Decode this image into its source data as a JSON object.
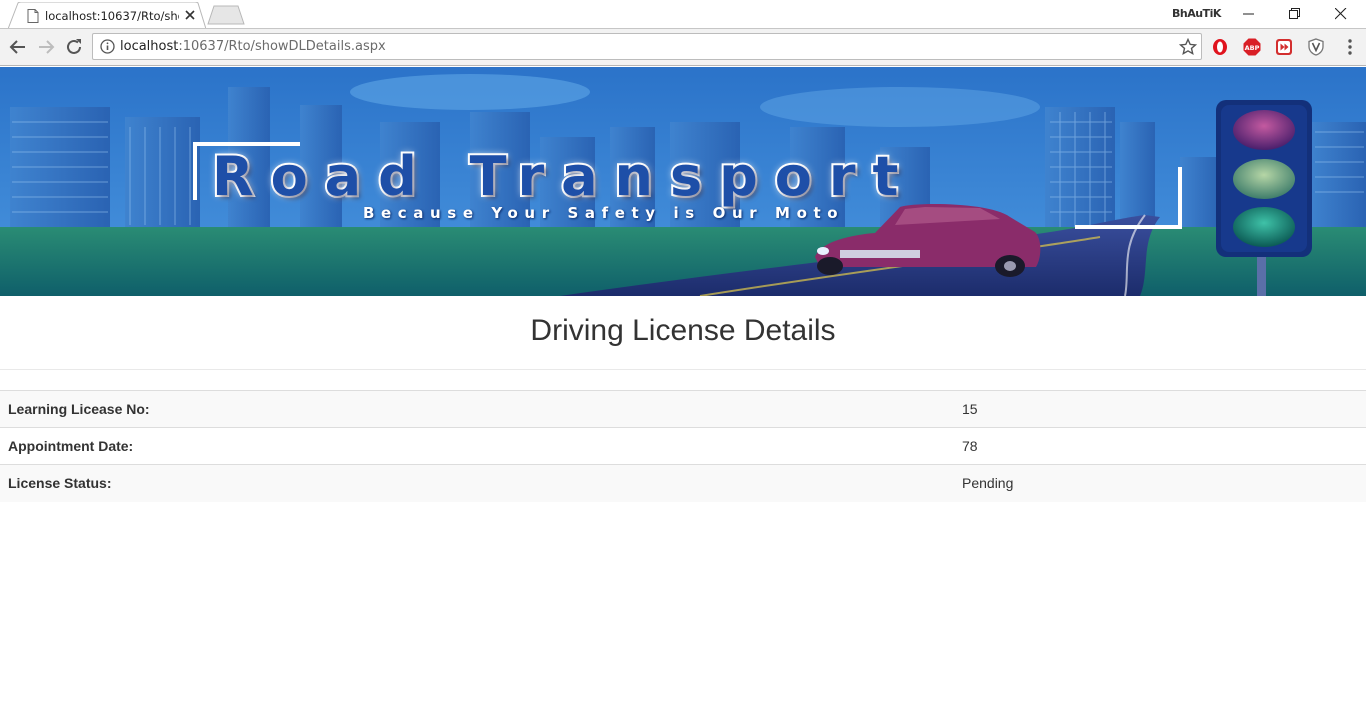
{
  "browser": {
    "tab_title": "localhost:10637/Rto/showDLDetails.aspx",
    "profile_name": "BhAuTiK",
    "url_host": "localhost",
    "url_path": ":10637/Rto/showDLDetails.aspx",
    "icons": [
      "page-icon",
      "close-icon",
      "back-icon",
      "forward-icon",
      "reload-icon",
      "info-icon",
      "star-icon",
      "opera-icon",
      "adblock-icon",
      "video-icon",
      "shield-icon",
      "menu-icon",
      "minimize-icon",
      "restore-icon",
      "window-close-icon"
    ]
  },
  "banner": {
    "title": "Road Transport",
    "tagline": "Because Your Safety is Our Moto"
  },
  "main": {
    "heading": "Driving License Details",
    "rows": [
      {
        "label": "Learning Licease No:",
        "value": "15"
      },
      {
        "label": "Appointment Date:",
        "value": "78"
      },
      {
        "label": "License Status:",
        "value": "Pending"
      }
    ]
  },
  "colors": {
    "banner_sky": "#2f7fd2",
    "banner_ground": "#1b7a6e",
    "text": "#333333"
  }
}
